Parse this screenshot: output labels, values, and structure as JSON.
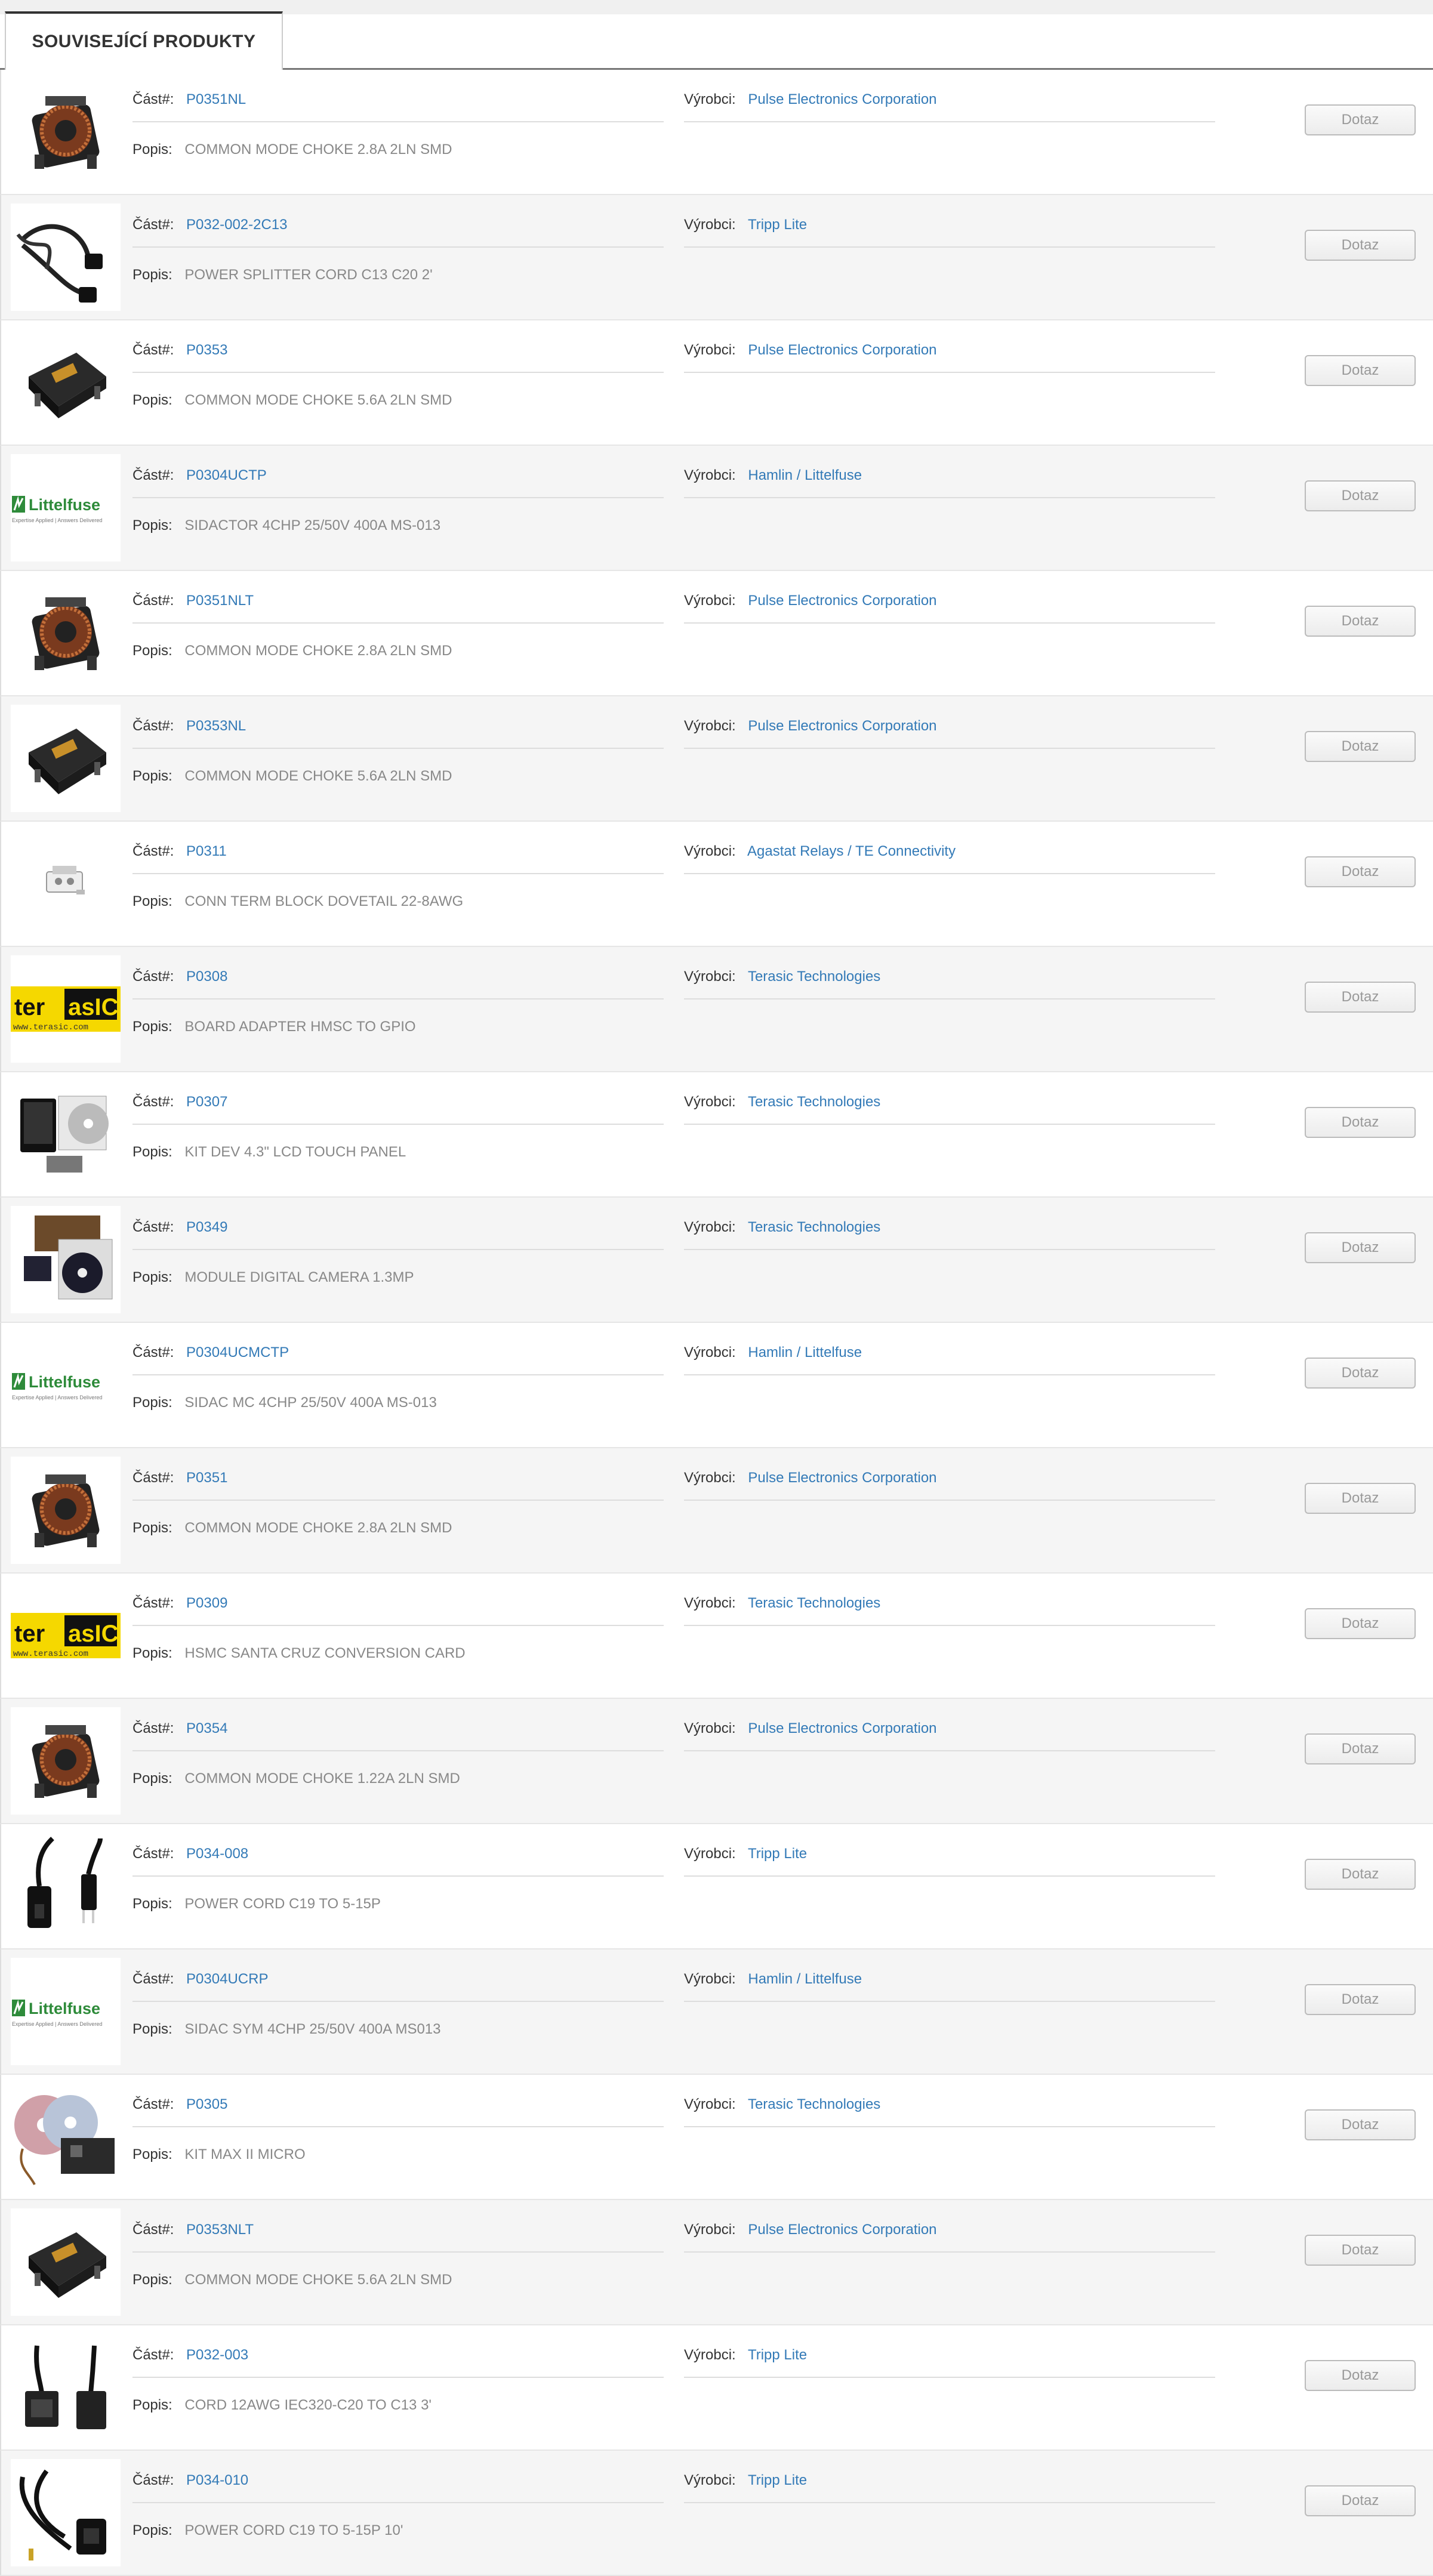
{
  "tab": {
    "label": "SOUVISEJÍCÍ PRODUKTY"
  },
  "labels": {
    "part": "Část#:",
    "desc": "Popis:",
    "mfr": "Výrobci:",
    "button": "Dotaz"
  },
  "logos": {
    "littelfuse_name": "Littelfuse",
    "littelfuse_tagline": "Expertise Applied | Answers Delivered",
    "terasic_name": "terasIC",
    "terasic_url": "www.terasic.com"
  },
  "products": [
    {
      "part": "P0351NL",
      "desc": "COMMON MODE CHOKE 2.8A 2LN SMD",
      "mfr": "Pulse Electronics Corporation",
      "image": "choke-toroid"
    },
    {
      "part": "P032-002-2C13",
      "desc": "POWER SPLITTER CORD C13 C20 2'",
      "mfr": "Tripp Lite",
      "image": "cable-splitter"
    },
    {
      "part": "P0353",
      "desc": "COMMON MODE CHOKE 5.6A 2LN SMD",
      "mfr": "Pulse Electronics Corporation",
      "image": "choke-block"
    },
    {
      "part": "P0304UCTP",
      "desc": "SIDACTOR 4CHP 25/50V 400A MS-013",
      "mfr": "Hamlin / Littelfuse",
      "image": "littelfuse-logo"
    },
    {
      "part": "P0351NLT",
      "desc": "COMMON MODE CHOKE 2.8A 2LN SMD",
      "mfr": "Pulse Electronics Corporation",
      "image": "choke-toroid"
    },
    {
      "part": "P0353NL",
      "desc": "COMMON MODE CHOKE 5.6A 2LN SMD",
      "mfr": "Pulse Electronics Corporation",
      "image": "choke-block"
    },
    {
      "part": "P0311",
      "desc": "CONN TERM BLOCK DOVETAIL 22-8AWG",
      "mfr": "Agastat Relays / TE Connectivity",
      "image": "terminal-block"
    },
    {
      "part": "P0308",
      "desc": "BOARD ADAPTER HMSC TO GPIO",
      "mfr": "Terasic Technologies",
      "image": "terasic-logo"
    },
    {
      "part": "P0307",
      "desc": "KIT DEV 4.3\" LCD TOUCH PANEL",
      "mfr": "Terasic Technologies",
      "image": "lcd-kit"
    },
    {
      "part": "P0349",
      "desc": "MODULE DIGITAL CAMERA 1.3MP",
      "mfr": "Terasic Technologies",
      "image": "camera-kit"
    },
    {
      "part": "P0304UCMCTP",
      "desc": "SIDAC MC 4CHP 25/50V 400A MS-013",
      "mfr": "Hamlin / Littelfuse",
      "image": "littelfuse-logo"
    },
    {
      "part": "P0351",
      "desc": "COMMON MODE CHOKE 2.8A 2LN SMD",
      "mfr": "Pulse Electronics Corporation",
      "image": "choke-toroid"
    },
    {
      "part": "P0309",
      "desc": "HSMC SANTA CRUZ CONVERSION CARD",
      "mfr": "Terasic Technologies",
      "image": "terasic-logo"
    },
    {
      "part": "P0354",
      "desc": "COMMON MODE CHOKE 1.22A 2LN SMD",
      "mfr": "Pulse Electronics Corporation",
      "image": "choke-toroid"
    },
    {
      "part": "P034-008",
      "desc": "POWER CORD C19 TO 5-15P",
      "mfr": "Tripp Lite",
      "image": "power-cord"
    },
    {
      "part": "P0304UCRP",
      "desc": "SIDAC SYM 4CHP 25/50V 400A MS013",
      "mfr": "Hamlin / Littelfuse",
      "image": "littelfuse-logo"
    },
    {
      "part": "P0305",
      "desc": "KIT MAX II MICRO",
      "mfr": "Terasic Technologies",
      "image": "max-kit"
    },
    {
      "part": "P0353NLT",
      "desc": "COMMON MODE CHOKE 5.6A 2LN SMD",
      "mfr": "Pulse Electronics Corporation",
      "image": "choke-block"
    },
    {
      "part": "P032-003",
      "desc": "CORD 12AWG IEC320-C20 TO C13 3'",
      "mfr": "Tripp Lite",
      "image": "power-cord-c20"
    },
    {
      "part": "P034-010",
      "desc": "POWER CORD C19 TO 5-15P 10'",
      "mfr": "Tripp Lite",
      "image": "power-cord-coil"
    }
  ]
}
